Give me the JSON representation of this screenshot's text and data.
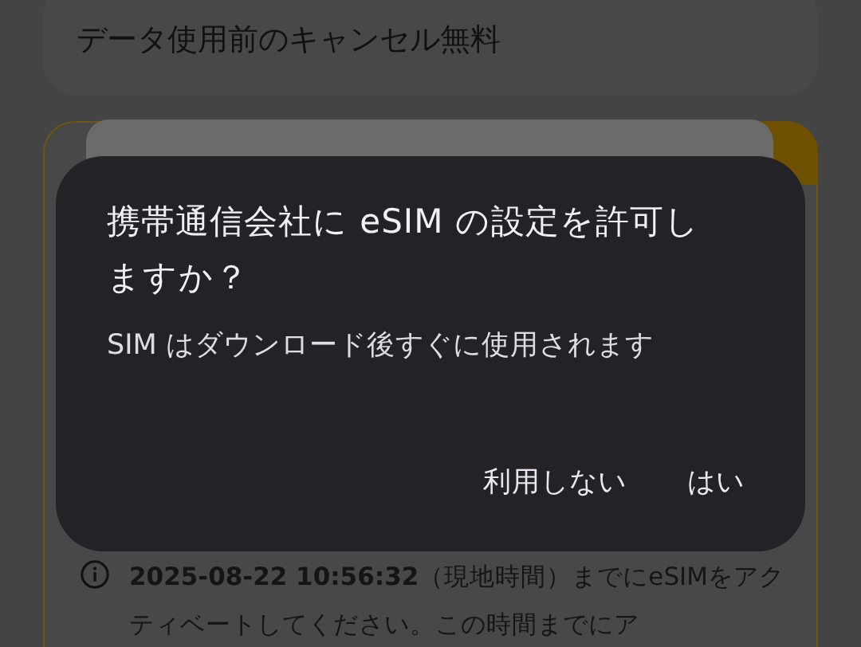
{
  "background_card": {
    "text": "データ使用前のキャンセル無料"
  },
  "plan_card": {
    "note": "**2025-08-22 10:56:32**（現地時間）までにeSIMをアクティベートしてください。この時間までにア"
  },
  "dialog": {
    "title": "携帯通信会社に eSIM の設定を許可しますか？",
    "message": "SIM はダウンロード後すぐに使用されます",
    "buttons": [
      {
        "label": "利用しない"
      },
      {
        "label": "はい"
      }
    ]
  }
}
